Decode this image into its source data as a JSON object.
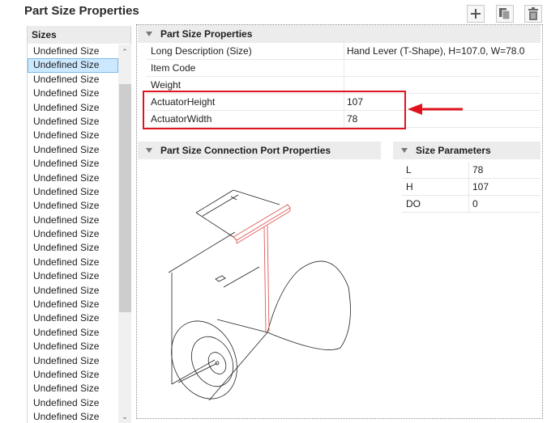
{
  "page": {
    "title": "Part Size Properties"
  },
  "toolbar": {
    "add_icon": "plus-icon",
    "copy_icon": "copy-icon",
    "delete_icon": "trash-icon"
  },
  "sizes": {
    "header": "Sizes",
    "items": [
      "Undefined Size",
      "Undefined Size",
      "Undefined Size",
      "Undefined Size",
      "Undefined Size",
      "Undefined Size",
      "Undefined Size",
      "Undefined Size",
      "Undefined Size",
      "Undefined Size",
      "Undefined Size",
      "Undefined Size",
      "Undefined Size",
      "Undefined Size",
      "Undefined Size",
      "Undefined Size",
      "Undefined Size",
      "Undefined Size",
      "Undefined Size",
      "Undefined Size",
      "Undefined Size",
      "Undefined Size",
      "Undefined Size",
      "Undefined Size",
      "Undefined Size",
      "Undefined Size",
      "Undefined Size",
      "Undefined Size"
    ],
    "selected_index": 1
  },
  "properties": {
    "header": "Part Size Properties",
    "rows": [
      {
        "key": "Long Description (Size)",
        "value": "Hand Lever (T-Shape), H=107.0, W=78.0"
      },
      {
        "key": "Item Code",
        "value": ""
      },
      {
        "key": "Weight",
        "value": ""
      },
      {
        "key": "ActuatorHeight",
        "value": "107"
      },
      {
        "key": "ActuatorWidth",
        "value": "78"
      }
    ]
  },
  "connection_ports": {
    "header": "Part Size Connection Port Properties"
  },
  "size_parameters": {
    "header": "Size Parameters",
    "rows": [
      {
        "key": "L",
        "value": "78"
      },
      {
        "key": "H",
        "value": "107"
      },
      {
        "key": "DO",
        "value": "0"
      }
    ]
  },
  "colors": {
    "highlight": "#e0141e",
    "selection": "#cce8ff",
    "header_bg": "#ececec"
  }
}
